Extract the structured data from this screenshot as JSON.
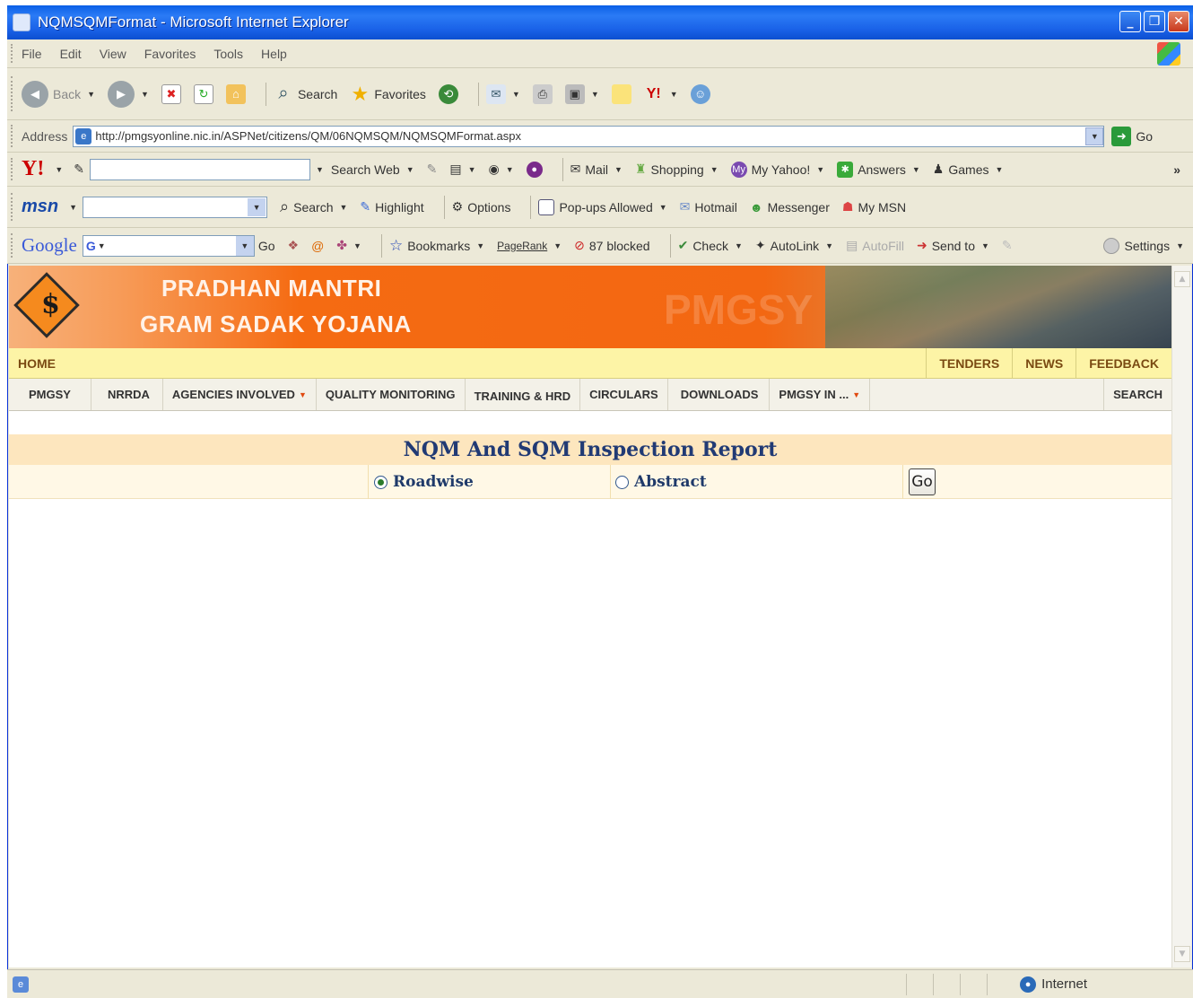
{
  "window": {
    "title": "NQMSQMFormat - Microsoft Internet Explorer"
  },
  "menu": [
    "File",
    "Edit",
    "View",
    "Favorites",
    "Tools",
    "Help"
  ],
  "toolbar": {
    "back": "Back",
    "search": "Search",
    "favorites": "Favorites"
  },
  "address": {
    "label": "Address",
    "url": "http://pmgsyonline.nic.in/ASPNet/citizens/QM/06NQMSQM/NQMSQMFormat.aspx",
    "go": "Go"
  },
  "yahoo": {
    "search_web": "Search Web",
    "mail": "Mail",
    "shopping": "Shopping",
    "my_yahoo": "My Yahoo!",
    "answers": "Answers",
    "games": "Games",
    "more": "»"
  },
  "msn": {
    "logo": "msn",
    "search": "Search",
    "highlight": "Highlight",
    "options": "Options",
    "popups": "Pop-ups Allowed",
    "hotmail": "Hotmail",
    "messenger": "Messenger",
    "mymsn": "My MSN"
  },
  "google": {
    "logo": "Google",
    "go": "Go",
    "bookmarks": "Bookmarks",
    "pagerank": "PageRank",
    "blocked": "87 blocked",
    "check": "Check",
    "autolink": "AutoLink",
    "autofill": "AutoFill",
    "sendto": "Send to",
    "settings": "Settings"
  },
  "banner": {
    "line1": "PRADHAN MANTRI",
    "line2": "GRAM SADAK YOJANA",
    "watermark": "PMGSY"
  },
  "nav_top": {
    "home": "HOME",
    "right": [
      "TENDERS",
      "NEWS",
      "FEEDBACK"
    ]
  },
  "nav_main": {
    "items": [
      {
        "label": "PMGSY",
        "dropdown": false
      },
      {
        "label": "NRRDA",
        "dropdown": false
      },
      {
        "label": "AGENCIES INVOLVED",
        "dropdown": true
      },
      {
        "label": "QUALITY MONITORING",
        "dropdown": false
      },
      {
        "label": "TRAINING & HRD",
        "dropdown": false
      },
      {
        "label": "CIRCULARS",
        "dropdown": false
      },
      {
        "label": "DOWNLOADS",
        "dropdown": false
      },
      {
        "label": "PMGSY IN ...",
        "dropdown": true
      }
    ],
    "search": "SEARCH"
  },
  "report": {
    "title": "NQM And SQM Inspection Report",
    "options": [
      {
        "label": "Roadwise",
        "selected": true
      },
      {
        "label": "Abstract",
        "selected": false
      }
    ],
    "go_label": "Go"
  },
  "status": {
    "zone": "Internet"
  }
}
